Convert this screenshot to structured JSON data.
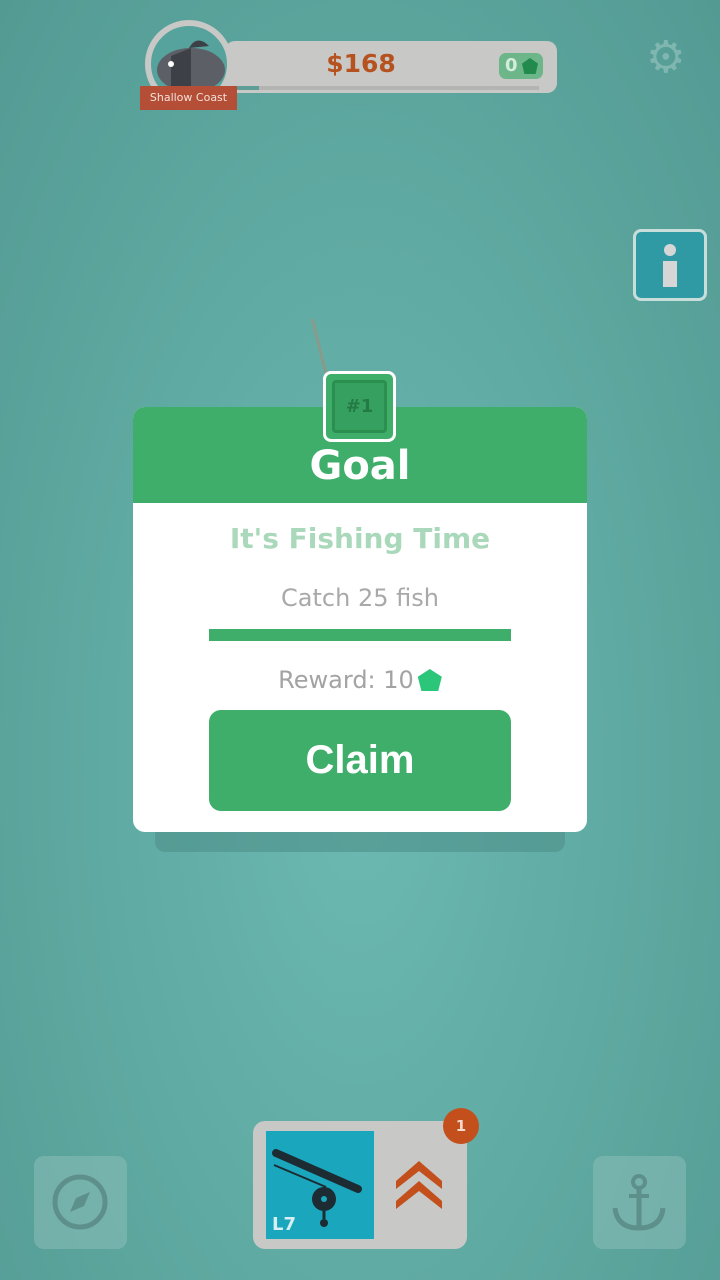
{
  "hud": {
    "money": "$168",
    "gems": "0",
    "location": "Shallow Coast",
    "xp_progress": 0.08
  },
  "goal": {
    "header": "Goal",
    "number": "#1",
    "title": "It's Fishing Time",
    "task": "Catch 25 fish",
    "progress": 1.0,
    "reward_label": "Reward: 10",
    "claim_label": "Claim"
  },
  "rod": {
    "level": "L7",
    "notification": "1"
  },
  "icons": {
    "settings": "gear-icon",
    "info": "info-icon",
    "compass": "compass-icon",
    "anchor": "anchor-icon",
    "upgrade": "double-chevron-up-icon",
    "gem": "gem-icon"
  },
  "colors": {
    "accent": "#3eae6a",
    "money": "#b5521f",
    "banner": "#b44e36"
  }
}
